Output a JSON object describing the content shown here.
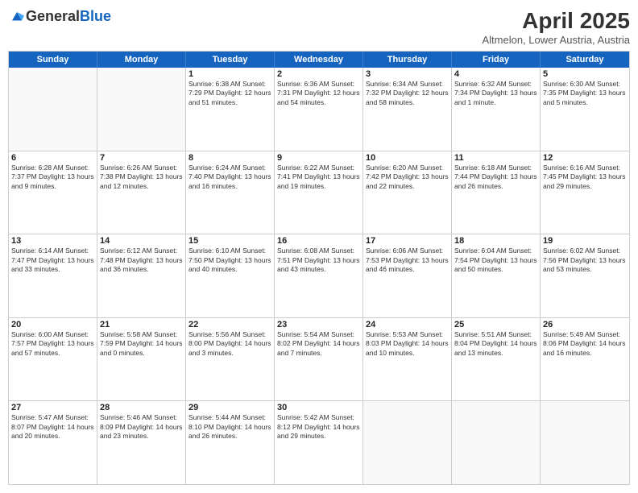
{
  "header": {
    "logo_general": "General",
    "logo_blue": "Blue",
    "month_title": "April 2025",
    "location": "Altmelon, Lower Austria, Austria"
  },
  "days_of_week": [
    "Sunday",
    "Monday",
    "Tuesday",
    "Wednesday",
    "Thursday",
    "Friday",
    "Saturday"
  ],
  "weeks": [
    [
      {
        "day": "",
        "info": ""
      },
      {
        "day": "",
        "info": ""
      },
      {
        "day": "1",
        "info": "Sunrise: 6:38 AM\nSunset: 7:29 PM\nDaylight: 12 hours\nand 51 minutes."
      },
      {
        "day": "2",
        "info": "Sunrise: 6:36 AM\nSunset: 7:31 PM\nDaylight: 12 hours\nand 54 minutes."
      },
      {
        "day": "3",
        "info": "Sunrise: 6:34 AM\nSunset: 7:32 PM\nDaylight: 12 hours\nand 58 minutes."
      },
      {
        "day": "4",
        "info": "Sunrise: 6:32 AM\nSunset: 7:34 PM\nDaylight: 13 hours\nand 1 minute."
      },
      {
        "day": "5",
        "info": "Sunrise: 6:30 AM\nSunset: 7:35 PM\nDaylight: 13 hours\nand 5 minutes."
      }
    ],
    [
      {
        "day": "6",
        "info": "Sunrise: 6:28 AM\nSunset: 7:37 PM\nDaylight: 13 hours\nand 9 minutes."
      },
      {
        "day": "7",
        "info": "Sunrise: 6:26 AM\nSunset: 7:38 PM\nDaylight: 13 hours\nand 12 minutes."
      },
      {
        "day": "8",
        "info": "Sunrise: 6:24 AM\nSunset: 7:40 PM\nDaylight: 13 hours\nand 16 minutes."
      },
      {
        "day": "9",
        "info": "Sunrise: 6:22 AM\nSunset: 7:41 PM\nDaylight: 13 hours\nand 19 minutes."
      },
      {
        "day": "10",
        "info": "Sunrise: 6:20 AM\nSunset: 7:42 PM\nDaylight: 13 hours\nand 22 minutes."
      },
      {
        "day": "11",
        "info": "Sunrise: 6:18 AM\nSunset: 7:44 PM\nDaylight: 13 hours\nand 26 minutes."
      },
      {
        "day": "12",
        "info": "Sunrise: 6:16 AM\nSunset: 7:45 PM\nDaylight: 13 hours\nand 29 minutes."
      }
    ],
    [
      {
        "day": "13",
        "info": "Sunrise: 6:14 AM\nSunset: 7:47 PM\nDaylight: 13 hours\nand 33 minutes."
      },
      {
        "day": "14",
        "info": "Sunrise: 6:12 AM\nSunset: 7:48 PM\nDaylight: 13 hours\nand 36 minutes."
      },
      {
        "day": "15",
        "info": "Sunrise: 6:10 AM\nSunset: 7:50 PM\nDaylight: 13 hours\nand 40 minutes."
      },
      {
        "day": "16",
        "info": "Sunrise: 6:08 AM\nSunset: 7:51 PM\nDaylight: 13 hours\nand 43 minutes."
      },
      {
        "day": "17",
        "info": "Sunrise: 6:06 AM\nSunset: 7:53 PM\nDaylight: 13 hours\nand 46 minutes."
      },
      {
        "day": "18",
        "info": "Sunrise: 6:04 AM\nSunset: 7:54 PM\nDaylight: 13 hours\nand 50 minutes."
      },
      {
        "day": "19",
        "info": "Sunrise: 6:02 AM\nSunset: 7:56 PM\nDaylight: 13 hours\nand 53 minutes."
      }
    ],
    [
      {
        "day": "20",
        "info": "Sunrise: 6:00 AM\nSunset: 7:57 PM\nDaylight: 13 hours\nand 57 minutes."
      },
      {
        "day": "21",
        "info": "Sunrise: 5:58 AM\nSunset: 7:59 PM\nDaylight: 14 hours\nand 0 minutes."
      },
      {
        "day": "22",
        "info": "Sunrise: 5:56 AM\nSunset: 8:00 PM\nDaylight: 14 hours\nand 3 minutes."
      },
      {
        "day": "23",
        "info": "Sunrise: 5:54 AM\nSunset: 8:02 PM\nDaylight: 14 hours\nand 7 minutes."
      },
      {
        "day": "24",
        "info": "Sunrise: 5:53 AM\nSunset: 8:03 PM\nDaylight: 14 hours\nand 10 minutes."
      },
      {
        "day": "25",
        "info": "Sunrise: 5:51 AM\nSunset: 8:04 PM\nDaylight: 14 hours\nand 13 minutes."
      },
      {
        "day": "26",
        "info": "Sunrise: 5:49 AM\nSunset: 8:06 PM\nDaylight: 14 hours\nand 16 minutes."
      }
    ],
    [
      {
        "day": "27",
        "info": "Sunrise: 5:47 AM\nSunset: 8:07 PM\nDaylight: 14 hours\nand 20 minutes."
      },
      {
        "day": "28",
        "info": "Sunrise: 5:46 AM\nSunset: 8:09 PM\nDaylight: 14 hours\nand 23 minutes."
      },
      {
        "day": "29",
        "info": "Sunrise: 5:44 AM\nSunset: 8:10 PM\nDaylight: 14 hours\nand 26 minutes."
      },
      {
        "day": "30",
        "info": "Sunrise: 5:42 AM\nSunset: 8:12 PM\nDaylight: 14 hours\nand 29 minutes."
      },
      {
        "day": "",
        "info": ""
      },
      {
        "day": "",
        "info": ""
      },
      {
        "day": "",
        "info": ""
      }
    ]
  ]
}
